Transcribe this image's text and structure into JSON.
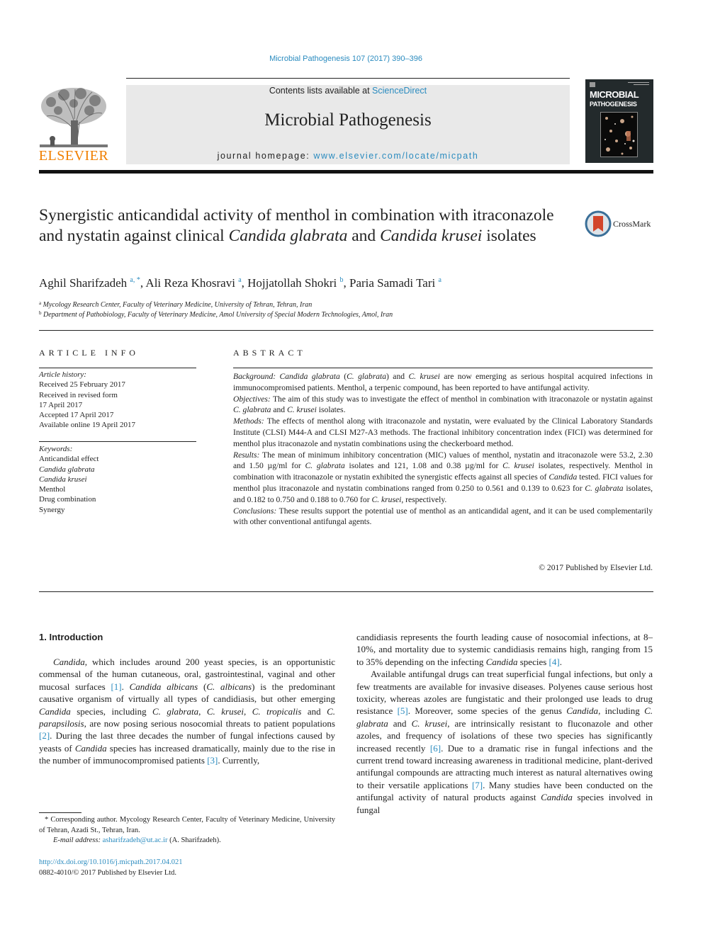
{
  "header": {
    "citation": "Microbial Pathogenesis 107 (2017) 390–396",
    "publisher_logo_text": "ELSEVIER",
    "contents_prefix": "Contents lists available at ",
    "contents_link": "ScienceDirect",
    "journal_title": "Microbial Pathogenesis",
    "homepage_prefix": "journal homepage: ",
    "homepage_link": "www.elsevier.com/locate/micpath",
    "cover_title_line1": "MICROBIAL",
    "cover_title_line2": "PATHOGENESIS"
  },
  "article": {
    "title_part1": "Synergistic anticandidal activity of menthol in combination with itraconazole and nystatin against clinical ",
    "title_italic1": "Candida glabrata",
    "title_part2": " and ",
    "title_italic2": "Candida krusei",
    "title_part3": " isolates",
    "crossmark_label": "CrossMark",
    "authors": [
      {
        "name": "Aghil Sharifzadeh",
        "sup": "a, *"
      },
      {
        "name": "Ali Reza Khosravi",
        "sup": "a"
      },
      {
        "name": "Hojjatollah Shokri",
        "sup": "b"
      },
      {
        "name": "Paria Samadi Tari",
        "sup": "a"
      }
    ],
    "affiliations": [
      {
        "mark": "a",
        "text": "Mycology Research Center, Faculty of Veterinary Medicine, University of Tehran, Tehran, Iran"
      },
      {
        "mark": "b",
        "text": "Department of Pathobiology, Faculty of Veterinary Medicine, Amol University of Special Modern Technologies, Amol, Iran"
      }
    ]
  },
  "article_info": {
    "heading": "ARTICLE INFO",
    "history_label": "Article history:",
    "history": [
      "Received 25 February 2017",
      "Received in revised form",
      "17 April 2017",
      "Accepted 17 April 2017",
      "Available online 19 April 2017"
    ],
    "keywords_label": "Keywords:",
    "keywords": [
      {
        "text": "Anticandidal effect",
        "italic": false
      },
      {
        "text": "Candida glabrata",
        "italic": true
      },
      {
        "text": "Candida krusei",
        "italic": true
      },
      {
        "text": "Menthol",
        "italic": false
      },
      {
        "text": "Drug combination",
        "italic": false
      },
      {
        "text": "Synergy",
        "italic": false
      }
    ]
  },
  "abstract": {
    "heading": "ABSTRACT",
    "background_label": "Background:",
    "background_text": "Candida glabrata (C. glabrata) and C. krusei are now emerging as serious hospital acquired infections in immunocompromised patients. Menthol, a terpenic compound, has been reported to have antifungal activity.",
    "objectives_label": "Objectives:",
    "objectives_text": "The aim of this study was to investigate the effect of menthol in combination with itraconazole or nystatin against C. glabrata and C. krusei isolates.",
    "methods_label": "Methods:",
    "methods_text": "The effects of menthol along with itraconazole and nystatin, were evaluated by the Clinical Laboratory Standards Institute (CLSI) M44-A and CLSI M27-A3 methods. The fractional inhibitory concentration index (FICI) was determined for menthol plus itraconazole and nystatin combinations using the checkerboard method.",
    "results_label": "Results:",
    "results_text": "The mean of minimum inhibitory concentration (MIC) values of menthol, nystatin and itraconazole were 53.2, 2.30 and 1.50 µg/ml for C. glabrata isolates and 121, 1.08 and 0.38 µg/ml for C. krusei isolates, respectively. Menthol in combination with itraconazole or nystatin exhibited the synergistic effects against all species of Candida tested. FICI values for menthol plus itraconazole and nystatin combinations ranged from 0.250 to 0.561 and 0.139 to 0.623 for C. glabrata isolates, and 0.182 to 0.750 and 0.188 to 0.760 for C. krusei, respectively.",
    "conclusions_label": "Conclusions:",
    "conclusions_text": "These results support the potential use of menthol as an anticandidal agent, and it can be used complementarily with other conventional antifungal agents.",
    "copyright": "© 2017 Published by Elsevier Ltd."
  },
  "introduction": {
    "heading": "1.  Introduction",
    "refs": [
      "[1]",
      "[2]",
      "[3]",
      "[4]",
      "[5]",
      "[6]",
      "[7]"
    ]
  },
  "footnotes": {
    "corresponding": "* Corresponding author. Mycology Research Center, Faculty of Veterinary Medicine, University of Tehran, Azadi St., Tehran, Iran.",
    "email_label": "E-mail address: ",
    "email": "asharifzadeh@ut.ac.ir",
    "email_suffix": " (A. Sharifzadeh).",
    "doi": "http://dx.doi.org/10.1016/j.micpath.2017.04.021",
    "issn": "0882-4010/© 2017 Published by Elsevier Ltd."
  }
}
